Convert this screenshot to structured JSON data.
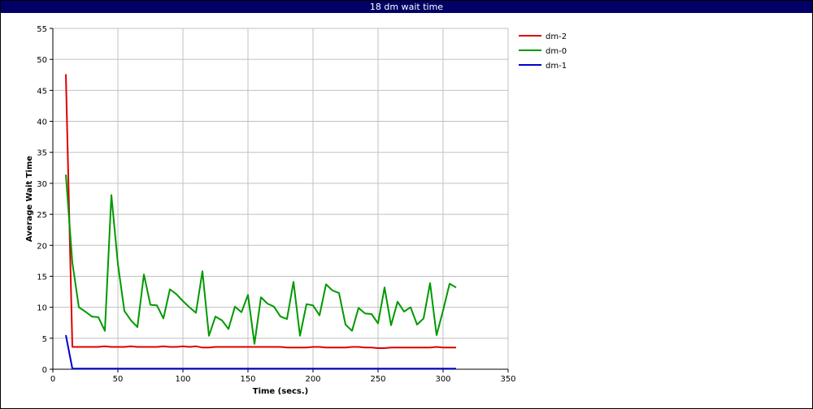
{
  "window": {
    "title": "18 dm wait time"
  },
  "chart_data": {
    "type": "line",
    "title": "18 dm wait time",
    "xlabel": "Time (secs.)",
    "ylabel": "Average Wait Time",
    "xlim": [
      0,
      350
    ],
    "ylim": [
      0,
      55
    ],
    "xticks": [
      0,
      50,
      100,
      150,
      200,
      250,
      300,
      350
    ],
    "yticks": [
      0,
      5,
      10,
      15,
      20,
      25,
      30,
      35,
      40,
      45,
      50,
      55
    ],
    "grid": true,
    "legend_position": "right",
    "series": [
      {
        "name": "dm-2",
        "color": "#dd0000",
        "x": [
          10,
          15,
          20,
          25,
          30,
          35,
          40,
          45,
          50,
          55,
          60,
          65,
          70,
          75,
          80,
          85,
          90,
          95,
          100,
          105,
          110,
          115,
          120,
          125,
          130,
          135,
          140,
          145,
          150,
          155,
          160,
          165,
          170,
          175,
          180,
          185,
          190,
          195,
          200,
          205,
          210,
          215,
          220,
          225,
          230,
          235,
          240,
          245,
          250,
          255,
          260,
          265,
          270,
          275,
          280,
          285,
          290,
          295,
          300,
          305,
          310
        ],
        "values": [
          47.6,
          3.6,
          3.6,
          3.6,
          3.6,
          3.6,
          3.7,
          3.6,
          3.6,
          3.6,
          3.7,
          3.6,
          3.6,
          3.6,
          3.6,
          3.7,
          3.6,
          3.6,
          3.7,
          3.6,
          3.7,
          3.5,
          3.5,
          3.6,
          3.6,
          3.6,
          3.6,
          3.6,
          3.6,
          3.6,
          3.6,
          3.6,
          3.6,
          3.6,
          3.5,
          3.5,
          3.5,
          3.5,
          3.6,
          3.6,
          3.5,
          3.5,
          3.5,
          3.5,
          3.6,
          3.6,
          3.5,
          3.5,
          3.4,
          3.4,
          3.5,
          3.5,
          3.5,
          3.5,
          3.5,
          3.5,
          3.5,
          3.6,
          3.5,
          3.5,
          3.5
        ]
      },
      {
        "name": "dm-0",
        "color": "#009900",
        "x": [
          10,
          15,
          20,
          25,
          30,
          35,
          40,
          45,
          50,
          55,
          60,
          65,
          70,
          75,
          80,
          85,
          90,
          95,
          100,
          105,
          110,
          115,
          120,
          125,
          130,
          135,
          140,
          145,
          150,
          155,
          160,
          165,
          170,
          175,
          180,
          185,
          190,
          195,
          200,
          205,
          210,
          215,
          220,
          225,
          230,
          235,
          240,
          245,
          250,
          255,
          260,
          265,
          270,
          275,
          280,
          285,
          290,
          295,
          300,
          305,
          310
        ],
        "values": [
          31.4,
          17.2,
          10.0,
          9.3,
          8.5,
          8.4,
          6.2,
          28.1,
          17.0,
          9.4,
          7.9,
          6.8,
          15.3,
          10.4,
          10.3,
          8.2,
          12.9,
          12.1,
          11.0,
          10.0,
          9.1,
          15.8,
          5.4,
          8.5,
          7.9,
          6.5,
          10.1,
          9.2,
          12.0,
          4.1,
          11.6,
          10.6,
          10.1,
          8.5,
          8.1,
          14.1,
          5.4,
          10.5,
          10.3,
          8.7,
          13.7,
          12.7,
          12.3,
          7.2,
          6.2,
          9.9,
          9.0,
          8.9,
          7.4,
          13.2,
          7.1,
          10.9,
          9.3,
          10.0,
          7.2,
          8.2,
          13.9,
          5.5,
          9.5,
          13.8,
          13.2
        ]
      },
      {
        "name": "dm-1",
        "color": "#0000cc",
        "x": [
          10,
          15,
          20,
          310
        ],
        "values": [
          5.5,
          0.1,
          0.1,
          0.1
        ]
      }
    ]
  }
}
